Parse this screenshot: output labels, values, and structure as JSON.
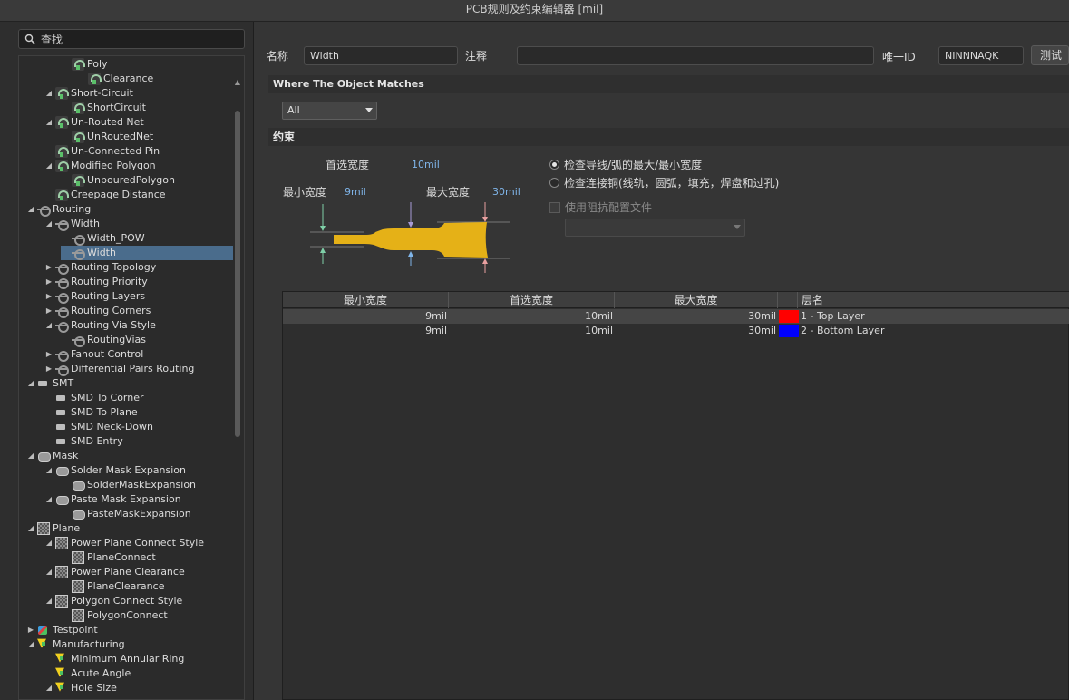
{
  "window": {
    "title": "PCB规则及约束编辑器 [mil]"
  },
  "search": {
    "placeholder": "查找"
  },
  "tree": {
    "items": [
      {
        "label": "Poly",
        "icon": "rule-icon",
        "arrow": ""
      },
      {
        "label": "Clearance",
        "icon": "rule-icon",
        "arrow": ""
      },
      {
        "label": "Short-Circuit",
        "icon": "rule-icon",
        "arrow": "◢"
      },
      {
        "label": "ShortCircuit",
        "icon": "rule-icon",
        "arrow": ""
      },
      {
        "label": "Un-Routed Net",
        "icon": "rule-icon",
        "arrow": "◢"
      },
      {
        "label": "UnRoutedNet",
        "icon": "rule-icon",
        "arrow": ""
      },
      {
        "label": "Un-Connected Pin",
        "icon": "rule-icon",
        "arrow": ""
      },
      {
        "label": "Modified Polygon",
        "icon": "rule-icon",
        "arrow": "◢"
      },
      {
        "label": "UnpouredPolygon",
        "icon": "rule-icon",
        "arrow": ""
      },
      {
        "label": "Creepage Distance",
        "icon": "rule-icon",
        "arrow": ""
      },
      {
        "label": "Routing",
        "icon": "routing-icon",
        "arrow": "◢"
      },
      {
        "label": "Width",
        "icon": "routing-icon",
        "arrow": "◢"
      },
      {
        "label": "Width_POW",
        "icon": "routing-icon",
        "arrow": ""
      },
      {
        "label": "Width",
        "icon": "routing-icon",
        "arrow": ""
      },
      {
        "label": "Routing Topology",
        "icon": "routing-icon",
        "arrow": "▶"
      },
      {
        "label": "Routing Priority",
        "icon": "routing-icon",
        "arrow": "▶"
      },
      {
        "label": "Routing Layers",
        "icon": "routing-icon",
        "arrow": "▶"
      },
      {
        "label": "Routing Corners",
        "icon": "routing-icon",
        "arrow": "▶"
      },
      {
        "label": "Routing Via Style",
        "icon": "routing-icon",
        "arrow": "◢"
      },
      {
        "label": "RoutingVias",
        "icon": "routing-icon",
        "arrow": ""
      },
      {
        "label": "Fanout Control",
        "icon": "routing-icon",
        "arrow": "▶"
      },
      {
        "label": "Differential Pairs Routing",
        "icon": "routing-icon",
        "arrow": "▶"
      },
      {
        "label": "SMT",
        "icon": "smt-icon",
        "arrow": "◢"
      },
      {
        "label": "SMD To Corner",
        "icon": "smt-icon",
        "arrow": ""
      },
      {
        "label": "SMD To Plane",
        "icon": "smt-icon",
        "arrow": ""
      },
      {
        "label": "SMD Neck-Down",
        "icon": "smt-icon",
        "arrow": ""
      },
      {
        "label": "SMD Entry",
        "icon": "smt-icon",
        "arrow": ""
      },
      {
        "label": "Mask",
        "icon": "mask-icon",
        "arrow": "◢"
      },
      {
        "label": "Solder Mask Expansion",
        "icon": "mask-icon",
        "arrow": "◢"
      },
      {
        "label": "SolderMaskExpansion",
        "icon": "mask-icon",
        "arrow": ""
      },
      {
        "label": "Paste Mask Expansion",
        "icon": "mask-icon",
        "arrow": "◢"
      },
      {
        "label": "PasteMaskExpansion",
        "icon": "mask-icon",
        "arrow": ""
      },
      {
        "label": "Plane",
        "icon": "plane-icon",
        "arrow": "◢"
      },
      {
        "label": "Power Plane Connect Style",
        "icon": "plane-icon",
        "arrow": "◢"
      },
      {
        "label": "PlaneConnect",
        "icon": "plane-icon",
        "arrow": ""
      },
      {
        "label": "Power Plane Clearance",
        "icon": "plane-icon",
        "arrow": "◢"
      },
      {
        "label": "PlaneClearance",
        "icon": "plane-icon",
        "arrow": ""
      },
      {
        "label": "Polygon Connect Style",
        "icon": "plane-icon",
        "arrow": "◢"
      },
      {
        "label": "PolygonConnect",
        "icon": "plane-icon",
        "arrow": ""
      },
      {
        "label": "Testpoint",
        "icon": "testpoint-icon",
        "arrow": "▶"
      },
      {
        "label": "Manufacturing",
        "icon": "manufacturing-icon",
        "arrow": "◢"
      },
      {
        "label": "Minimum Annular Ring",
        "icon": "manufacturing-icon",
        "arrow": ""
      },
      {
        "label": "Acute Angle",
        "icon": "manufacturing-icon",
        "arrow": ""
      },
      {
        "label": "Hole Size",
        "icon": "manufacturing-icon",
        "arrow": "◢"
      }
    ]
  },
  "form": {
    "name_label": "名称",
    "name_value": "Width",
    "comment_label": "注释",
    "comment_value": "",
    "uid_label": "唯一ID",
    "uid_value": "NINNNAQK",
    "test_button": "测试语句"
  },
  "where": {
    "title": "Where The Object Matches",
    "scope_value": "All"
  },
  "constraints": {
    "title": "约束",
    "preferred_label": "首选宽度",
    "preferred_value": "10mil",
    "min_label": "最小宽度",
    "min_value": "9mil",
    "max_label": "最大宽度",
    "max_value": "30mil",
    "radio1": "检查导线/弧的最大/最小宽度",
    "radio2": "检查连接铜(线轨，圆弧，填充，焊盘和过孔)",
    "impedance_check": "使用阻抗配置文件",
    "trace_color": "#e5b117",
    "text_accent": "#7fb4e8"
  },
  "grid": {
    "headers": [
      "最小宽度",
      "首选宽度",
      "最大宽度",
      "层名"
    ],
    "rows": [
      {
        "min": "9mil",
        "pref": "10mil",
        "max": "30mil",
        "color": "#ff0000",
        "layer": "1 - Top Layer"
      },
      {
        "min": "9mil",
        "pref": "10mil",
        "max": "30mil",
        "color": "#0000ff",
        "layer": "2 - Bottom Layer"
      }
    ]
  }
}
